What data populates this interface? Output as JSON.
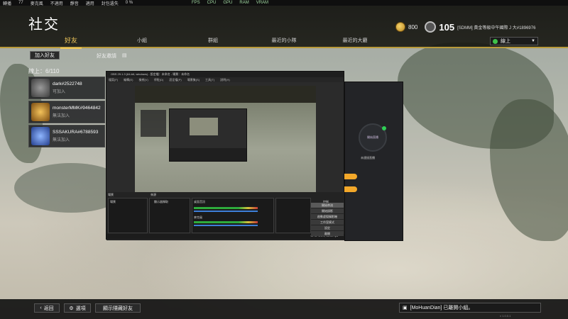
{
  "top_strip": {
    "ping_label": "轉播",
    "ping_value": "77",
    "voice_label": "麥克風",
    "voice_value": "不適用",
    "mute_label": "靜音",
    "mute_value": "適用",
    "privacy_label": "封包遺失",
    "privacy_value": "0 %",
    "stats": [
      "FPS",
      "CPU",
      "GPU",
      "RAM",
      "VRAM"
    ]
  },
  "header": {
    "title": "社交",
    "tabs": [
      "好友",
      "小組",
      "群組",
      "最近的小隊",
      "最近的大廳"
    ],
    "active_tab": 0,
    "currency_value": "800",
    "level": "105",
    "player_id": "[SDMM] 黃金等級中午國際 J 大#1896976",
    "status": "線上"
  },
  "friends": {
    "add_button": "加入好友",
    "invite_label": "好友邀請",
    "invite_icon": "invite-icon",
    "online_count": "線上：6/110",
    "list": [
      {
        "name": "dark#2522748",
        "status": "可加入",
        "color": "#8d8d8d"
      },
      {
        "name": "monsterMMK#9464842",
        "status": "無法加入",
        "color": "#d4902a"
      },
      {
        "name": "SSSAKURA#6788593",
        "status": "無法加入",
        "color": "#4a7be0"
      }
    ]
  },
  "obs": {
    "title": "OBS 29.1.3 (64-bit, windows) - 設定檔：未命名 - 場景：未命名",
    "menu": [
      "檔案(F)",
      "編輯(E)",
      "檢視(V)",
      "停駐(D)",
      "設定檔(P)",
      "場景集(S)",
      "工具(T)",
      "說明(H)"
    ],
    "scenes_label": "場景",
    "scene_item": "場景",
    "sources_label": "來源",
    "source_item": "顯示器擷取",
    "mixer_label": "混音器",
    "mixer_track1": "桌面音訊",
    "mixer_track2": "麥克風",
    "transitions_label": "場景轉換",
    "controls_label": "控制",
    "controls": [
      "開始串流",
      "開始錄影",
      "啟動虛擬攝影機",
      "工作室模式",
      "設定",
      "離開"
    ],
    "status": "CPU: 1.5%, 60.00 fps"
  },
  "app": {
    "ring_label": "開始直播",
    "hint": "未連接直播"
  },
  "bottom": {
    "back": "返回",
    "options": "選項",
    "show_hidden": "顯示隱藏好友",
    "notification": "[MoHuanDian] 已離開小組。",
    "version": "v 1.0.0.1"
  }
}
